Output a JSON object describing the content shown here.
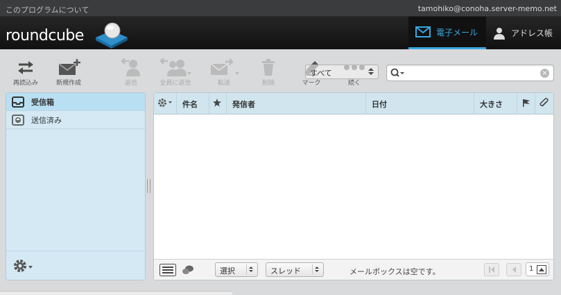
{
  "topline": {
    "about": "このプログラムについて",
    "user": "tamohiko@conoha.server-memo.net"
  },
  "logo": {
    "text": "roundcube"
  },
  "tasks": {
    "mail": "電子メール",
    "addressbook": "アドレス帳"
  },
  "toolbar": {
    "refresh": "再読込み",
    "compose": "新規作成",
    "reply": "返信",
    "reply_all": "全員に返信",
    "forward": "転送",
    "delete": "削除",
    "mark": "マーク",
    "more": "続く"
  },
  "filter": {
    "selected": "すべて"
  },
  "search": {
    "placeholder": "",
    "value": ""
  },
  "folders": [
    {
      "label": "受信箱",
      "icon": "inbox-icon",
      "selected": true
    },
    {
      "label": "送信済み",
      "icon": "sent-icon",
      "selected": false
    }
  ],
  "columns": {
    "subject": "件名",
    "from": "発信者",
    "date": "日付",
    "size": "大きさ"
  },
  "list_footer": {
    "select": "選択",
    "threads": "スレッド",
    "empty": "メールボックスは空です。",
    "page": "1"
  },
  "colors": {
    "accent": "#37a9e1",
    "folder_bg": "#d4e9f4",
    "header_bg": "#d1e5ef"
  }
}
